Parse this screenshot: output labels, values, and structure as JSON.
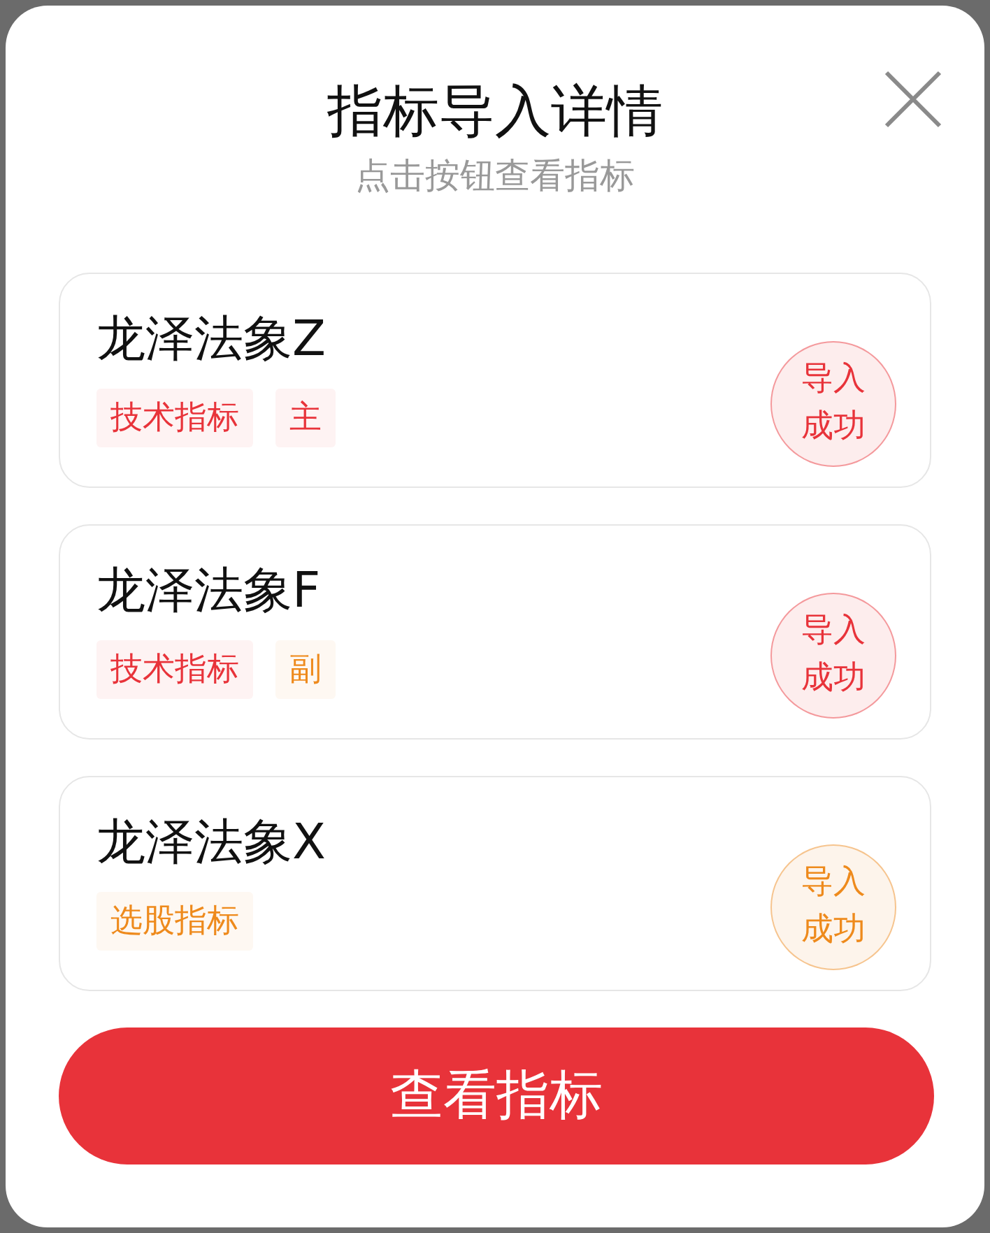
{
  "dialog": {
    "title": "指标导入详情",
    "subtitle": "点击按钮查看指标"
  },
  "items": [
    {
      "name": "龙泽法象Z",
      "tags": [
        {
          "label": "技术指标",
          "color": "#e8333a"
        },
        {
          "label": "主",
          "color": "#e8333a"
        }
      ],
      "status": {
        "label_1": "导入",
        "label_2": "成功",
        "color": "#e8333a"
      }
    },
    {
      "name": "龙泽法象F",
      "tags": [
        {
          "label": "技术指标",
          "color": "#e8333a"
        },
        {
          "label": "副",
          "color": "#ee8a1c"
        }
      ],
      "status": {
        "label_1": "导入",
        "label_2": "成功",
        "color": "#e8333a"
      }
    },
    {
      "name": "龙泽法象X",
      "tags": [
        {
          "label": "选股指标",
          "color": "#ee8a1c"
        }
      ],
      "status": {
        "label_1": "导入",
        "label_2": "成功",
        "color": "#ee8a1c"
      }
    }
  ],
  "primary_button": {
    "label": "查看指标"
  }
}
